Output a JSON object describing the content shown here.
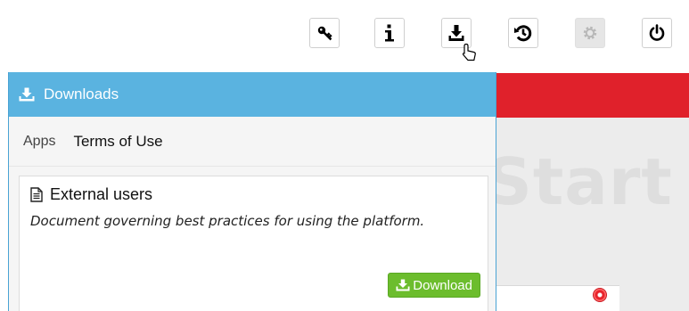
{
  "toolbar": {
    "buttons": [
      {
        "icon": "key-icon",
        "enabled": true
      },
      {
        "icon": "info-icon",
        "enabled": true
      },
      {
        "icon": "download-icon",
        "enabled": true
      },
      {
        "icon": "history-icon",
        "enabled": true
      },
      {
        "icon": "gear-icon",
        "enabled": false
      },
      {
        "icon": "power-icon",
        "enabled": true
      }
    ]
  },
  "background": {
    "heading_text": "Start",
    "accent_color": "#e0212b"
  },
  "downloads_panel": {
    "title": "Downloads",
    "header_color": "#5ab3e0",
    "tabs": [
      {
        "label": "Apps",
        "active": false
      },
      {
        "label": "Terms of Use",
        "active": true
      }
    ],
    "documents": [
      {
        "title": "External users",
        "description": "Document governing best practices for using the platform.",
        "action_label": "Download",
        "action_color": "#6cbd2d"
      }
    ]
  }
}
